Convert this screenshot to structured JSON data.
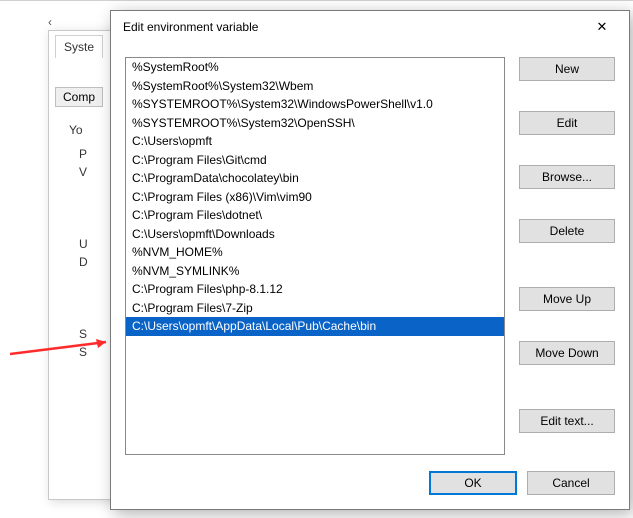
{
  "underlying": {
    "tab_label": "Syste",
    "comp_btn": "Comp",
    "yo": "Yo",
    "p": "P",
    "v": "V",
    "u": "U",
    "d": "D",
    "s1": "S",
    "s2": "S"
  },
  "dialog": {
    "title": "Edit environment variable",
    "close": "✕"
  },
  "list": {
    "items": [
      "%SystemRoot%",
      "%SystemRoot%\\System32\\Wbem",
      "%SYSTEMROOT%\\System32\\WindowsPowerShell\\v1.0",
      "%SYSTEMROOT%\\System32\\OpenSSH\\",
      "C:\\Users\\opmft",
      "C:\\Program Files\\Git\\cmd",
      "C:\\ProgramData\\chocolatey\\bin",
      "C:\\Program Files (x86)\\Vim\\vim90",
      "C:\\Program Files\\dotnet\\",
      "C:\\Users\\opmft\\Downloads",
      "%NVM_HOME%",
      "%NVM_SYMLINK%",
      "C:\\Program Files\\php-8.1.12",
      "C:\\Program Files\\7-Zip",
      "C:\\Users\\opmft\\AppData\\Local\\Pub\\Cache\\bin"
    ],
    "selected_index": 14
  },
  "buttons": {
    "new": "New",
    "edit": "Edit",
    "browse": "Browse...",
    "delete": "Delete",
    "move_up": "Move Up",
    "move_down": "Move Down",
    "edit_text": "Edit text..."
  },
  "footer": {
    "ok": "OK",
    "cancel": "Cancel"
  }
}
